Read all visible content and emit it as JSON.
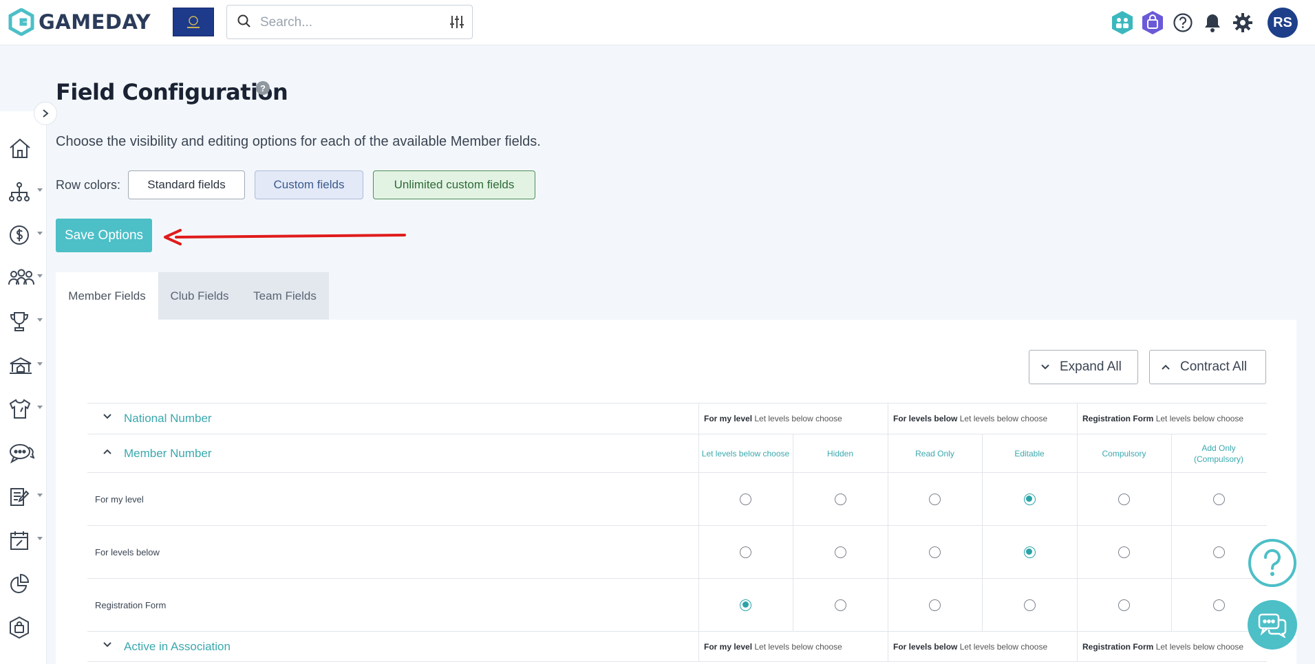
{
  "brand": {
    "name": "GAMEDAY",
    "accent": "#4cbfc7",
    "navy": "#1e3f8a"
  },
  "search": {
    "placeholder": "Search..."
  },
  "user": {
    "initials": "RS"
  },
  "page": {
    "title": "Field Configuration",
    "subtitle": "Choose the visibility and editing options for each of the available Member fields.",
    "row_colors_label": "Row colors:",
    "row_colors": [
      "Standard fields",
      "Custom fields",
      "Unlimited custom fields"
    ],
    "save_label": "Save Options"
  },
  "tabs": [
    "Member Fields",
    "Club Fields",
    "Team Fields"
  ],
  "actions": {
    "expand": "Expand All",
    "contract": "Contract All"
  },
  "table": {
    "summary_parts": {
      "my_level": "For my level",
      "levels_below": "For levels below",
      "reg_form": "Registration Form",
      "value": "Let levels below choose"
    },
    "columns": [
      "Let levels below choose",
      "Hidden",
      "Read Only",
      "Editable",
      "Compulsory",
      "Add Only (Compulsory)"
    ],
    "fields": [
      {
        "name": "National Number",
        "expanded": false
      },
      {
        "name": "Member Number",
        "expanded": true,
        "rows": [
          {
            "label": "For my level",
            "selected": 3
          },
          {
            "label": "For levels below",
            "selected": 3
          },
          {
            "label": "Registration Form",
            "selected": 0
          }
        ]
      },
      {
        "name": "Active in Association",
        "expanded": false
      }
    ]
  }
}
